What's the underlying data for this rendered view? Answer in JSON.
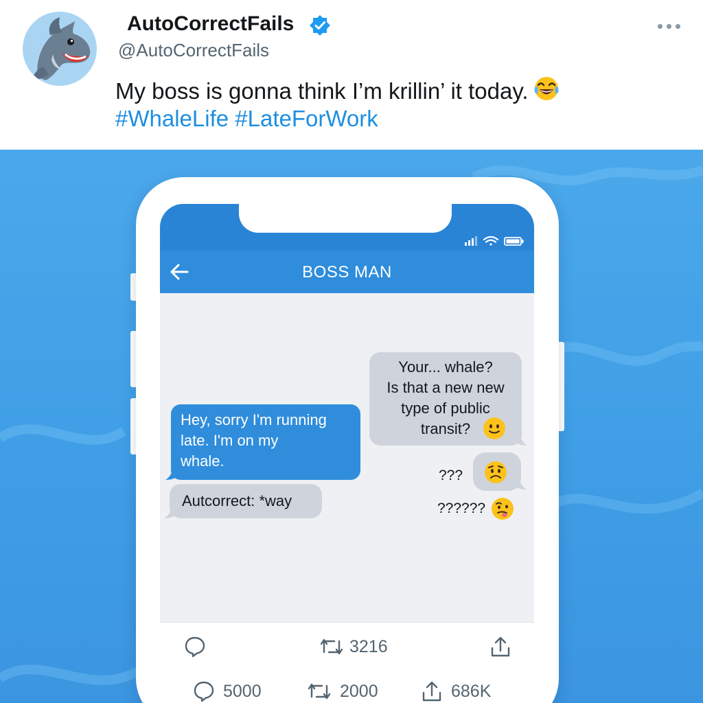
{
  "tweet": {
    "display_name": "AutoCorrectFails",
    "handle": "@AutoCorrectFails",
    "text": "My boss is gonna think I’m krillin’ it today.",
    "hashtags": [
      "#WhaleLife",
      "#LateForWork"
    ],
    "avatar_icon": "dolphin-icon",
    "verified_icon": "verified-badge-icon",
    "more_icon": "more-options-icon"
  },
  "chat": {
    "title": "BOSS MAN",
    "sent_message": [
      "Hey, sorry I'm running",
      "late. I'm on my",
      "whale."
    ],
    "autocorrect_message": "Autcorrect: *way",
    "received_message": [
      "Your... whale?",
      "Is that a new new",
      "type of public",
      "transit?"
    ],
    "reply_short": "???",
    "reply_long": "??????"
  },
  "screen_actions": {
    "reply_count": "",
    "retweet_count": "3216"
  },
  "tweet_actions": {
    "reply_count": "5000",
    "retweet_count": "2000",
    "share_count": "686K"
  },
  "colors": {
    "accent": "#1d8ee0",
    "bubble_out": "#2f8ddc",
    "bubble_in": "#cfd4dc",
    "background": "#3f9ee6"
  }
}
